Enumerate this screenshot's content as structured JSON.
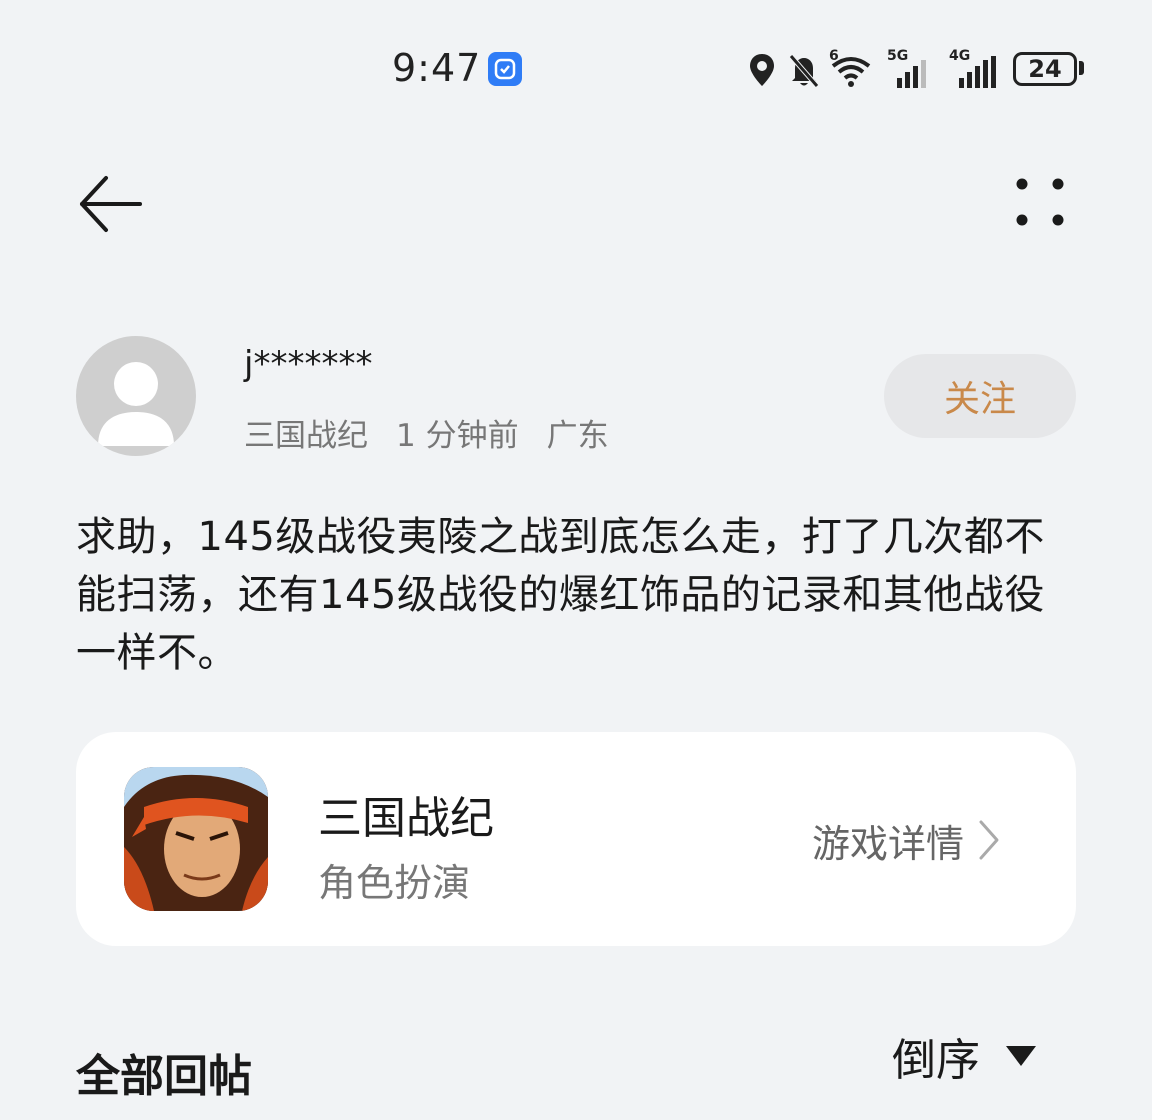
{
  "status_bar": {
    "time": "9:47",
    "signal_1_label": "5G",
    "signal_2_label": "4G",
    "wifi_label": "6",
    "battery": "24",
    "icons": [
      "location-icon",
      "bell-muted-icon",
      "wifi-icon",
      "signal-icon",
      "battery-icon"
    ]
  },
  "nav": {
    "back_icon": "arrow-left-icon",
    "more_icon": "more-dots-icon"
  },
  "post": {
    "username": "j*******",
    "game": "三国战纪",
    "time_ago": "1 分钟前",
    "location": "广东",
    "follow_label": "关注",
    "body": "求助，145级战役夷陵之战到底怎么走，打了几次都不能扫荡，还有145级战役的爆红饰品的记录和其他战役一样不。"
  },
  "game_card": {
    "title": "三国战纪",
    "genre": "角色扮演",
    "detail_label": "游戏详情"
  },
  "replies": {
    "title": "全部回帖",
    "sort_label": "倒序"
  },
  "colors": {
    "background": "#f1f3f5",
    "follow_text": "#c9894a",
    "follow_bg": "#e6e7e9",
    "card_bg": "#ffffff",
    "badge_blue": "#2f7cf6"
  }
}
